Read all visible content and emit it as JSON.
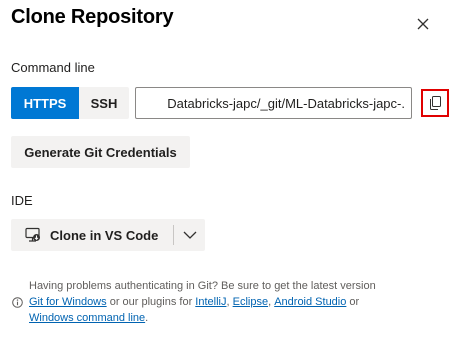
{
  "dialog": {
    "title": "Clone Repository",
    "close_icon": "close-icon"
  },
  "command_line": {
    "label": "Command line",
    "https_label": "HTTPS",
    "ssh_label": "SSH",
    "selected_protocol": "HTTPS",
    "url_value": ".-Databricks-japc/_git/ML-Databricks-japc",
    "copy_icon": "copy-icon",
    "generate_credentials_label": "Generate Git Credentials"
  },
  "ide": {
    "label": "IDE",
    "clone_label": "Clone in VS Code",
    "clone_icon": "vs-code-icon",
    "dropdown_icon": "chevron-down-icon"
  },
  "help": {
    "line1": "Having problems authenticating in Git? Be sure to get the latest version",
    "git_for_windows": "Git for Windows",
    "or_plugins": " or our plugins for ",
    "intellij": "IntelliJ",
    "comma1": ", ",
    "eclipse": "Eclipse",
    "comma2": ", ",
    "android_studio": "Android Studio",
    "or": " or",
    "windows_command_line": "Windows command line",
    "period": ".",
    "info_icon": "info-icon"
  },
  "colors": {
    "primary": "#0078d4",
    "secondary_button_bg": "#f3f2f1",
    "highlight_border": "#e00000",
    "link": "#0063b1"
  }
}
